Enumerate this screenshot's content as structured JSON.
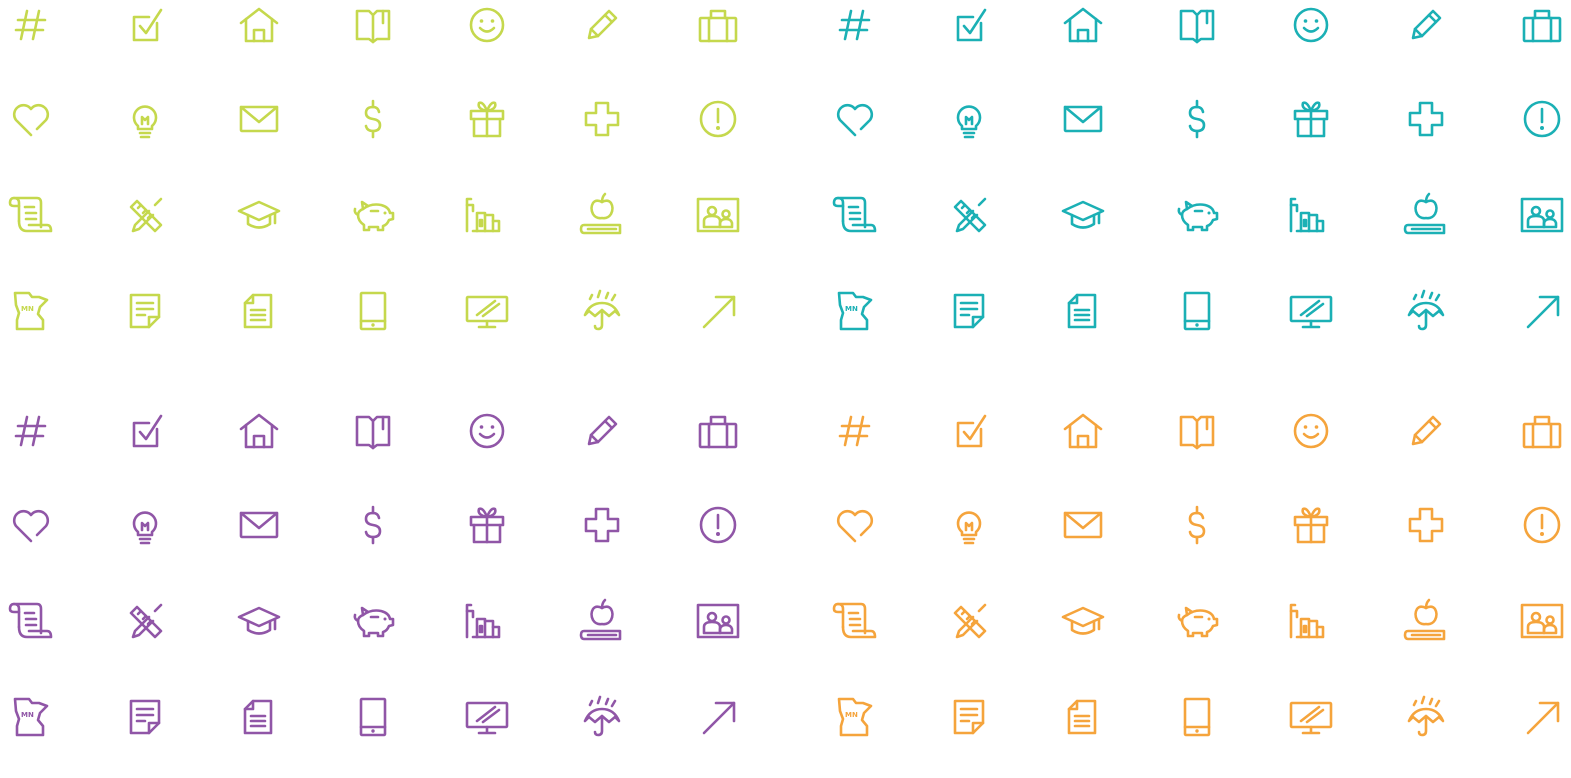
{
  "icon_rows": [
    [
      "hashtag-icon",
      "checkbox-icon",
      "house-icon",
      "book-icon",
      "smiley-icon",
      "pencil-icon",
      "briefcase-icon"
    ],
    [
      "heart-icon",
      "lightbulb-icon",
      "envelope-icon",
      "dollar-icon",
      "gift-icon",
      "medical-cross-icon",
      "alert-icon"
    ],
    [
      "scroll-icon",
      "ruler-pencil-icon",
      "graduation-cap-icon",
      "piggy-bank-icon",
      "community-buildings-icon",
      "apple-books-icon",
      "family-photo-icon"
    ],
    [
      "minnesota-icon",
      "notepad-icon",
      "document-icon",
      "tablet-icon",
      "monitor-icon",
      "umbrella-rain-icon",
      "arrow-up-right-icon"
    ]
  ],
  "icon_sets": [
    {
      "color": "#c5d84d"
    },
    {
      "color": "#1bb0b5"
    },
    {
      "color": "#9056a7"
    },
    {
      "color": "#f5a43c"
    }
  ],
  "minnesota_label": "MN"
}
